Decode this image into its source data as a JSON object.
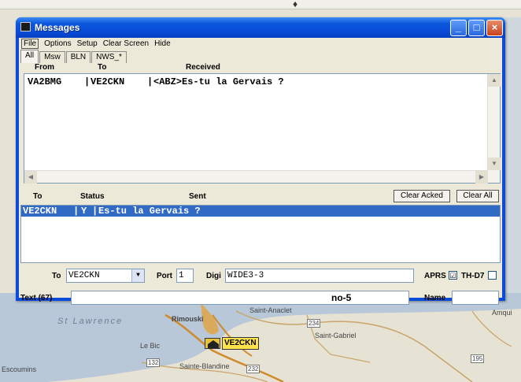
{
  "window": {
    "title": "Messages",
    "min": "_",
    "max": "□",
    "close": "×"
  },
  "menu": [
    "File",
    "Options",
    "Setup",
    "Clear Screen",
    "Hide"
  ],
  "tabs": [
    "All",
    "Msw",
    "BLN",
    "NWS_*"
  ],
  "received": {
    "headers": {
      "from": "From",
      "to": "To",
      "received": "Received"
    },
    "rows": [
      {
        "from": "VA2BMG",
        "to": "VE2CKN",
        "text": "<ABZ>Es-tu la Gervais ?"
      }
    ]
  },
  "sent": {
    "headers": {
      "to": "To",
      "status": "Status",
      "sent": "Sent"
    },
    "clear_acked": "Clear Acked",
    "clear_all": "Clear All",
    "rows": [
      {
        "to": "VE2CKN",
        "status": "Y",
        "text": "Es-tu la Gervais ?"
      }
    ]
  },
  "form": {
    "to_label": "To",
    "to_value": "VE2CKN",
    "port_label": "Port",
    "port_value": "1",
    "digi_label": "Digi",
    "digi_value": "WIDE3-3",
    "aprs_label": "APRS",
    "aprs_checked": "☑",
    "th_label": "TH-D7",
    "text_label": "Text (67)",
    "text_value": "",
    "counter": "no-5",
    "name_label": "Name",
    "name_value": ""
  },
  "map": {
    "labels": [
      "St Lawrence",
      "Rimouski",
      "Saint-Anaclet",
      "Saint-Gabriel",
      "Le Bic",
      "Sainte-Blandine",
      "VE2CKN",
      "Amqui",
      "132",
      "234",
      "195",
      "232",
      "Escoumins"
    ],
    "water_color": "#b8c8d8",
    "land_color": "#e6e2d4",
    "road_color": "#d08a2e"
  }
}
